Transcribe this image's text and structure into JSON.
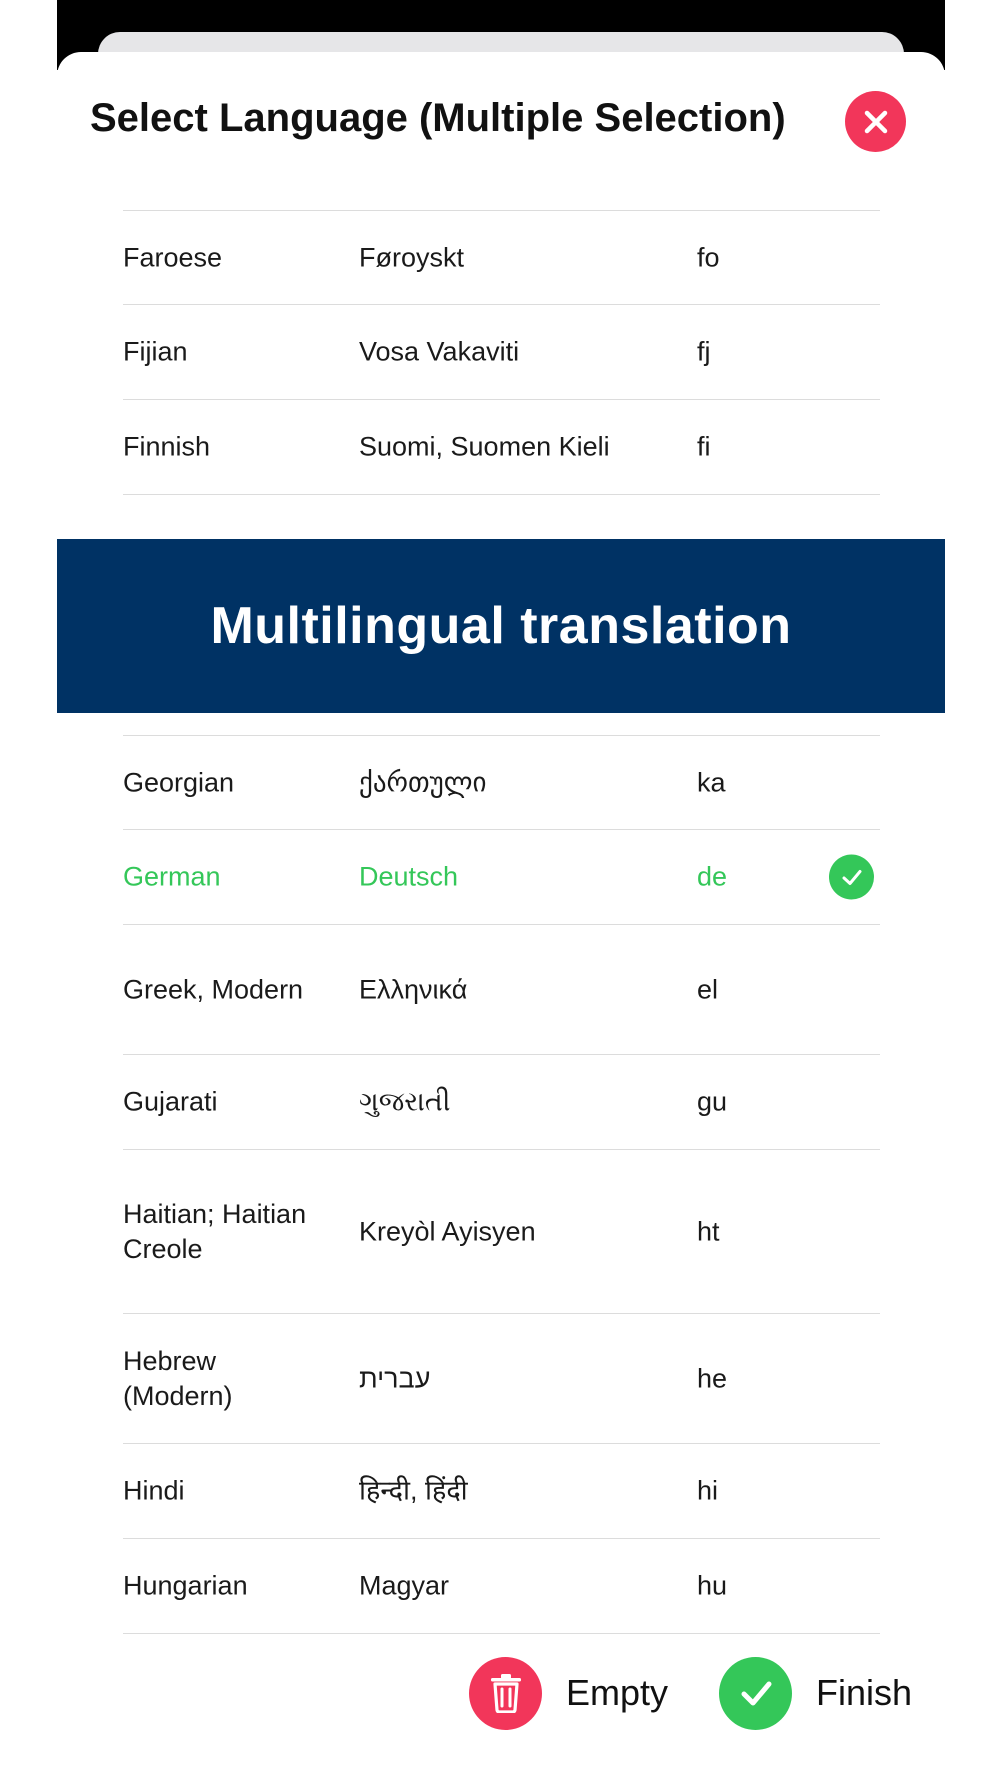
{
  "dialog": {
    "title": "Select Language (Multiple Selection)",
    "close_icon": "close-x-icon"
  },
  "banner": {
    "text": "Multilingual translation",
    "background": "#003264"
  },
  "languages_top": [
    {
      "name": "Faroese",
      "native": "Føroyskt",
      "code": "fo"
    },
    {
      "name": "Fijian",
      "native": "Vosa Vakaviti",
      "code": "fj"
    },
    {
      "name": "Finnish",
      "native": "Suomi, Suomen Kieli",
      "code": "fi"
    }
  ],
  "languages_bottom": [
    {
      "name": "Georgian",
      "native": "ქართული",
      "code": "ka"
    },
    {
      "name": "German",
      "native": "Deutsch",
      "code": "de",
      "selected": true
    },
    {
      "name": "Greek, Modern",
      "native": "Ελληνικά",
      "code": "el"
    },
    {
      "name": "Gujarati",
      "native": "ગુજરાતી",
      "code": "gu"
    },
    {
      "name": "Haitian; Haitian Creole",
      "native": "Kreyòl Ayisyen",
      "code": "ht"
    },
    {
      "name": "Hebrew (Modern)",
      "native": "עברית",
      "code": "he"
    },
    {
      "name": "Hindi",
      "native": "हिन्दी, हिंदी",
      "code": "hi"
    },
    {
      "name": "Hungarian",
      "native": "Magyar",
      "code": "hu"
    }
  ],
  "actions": {
    "empty_label": "Empty",
    "empty_icon": "trash-icon",
    "finish_label": "Finish",
    "finish_icon": "checkmark-icon"
  },
  "colors": {
    "accent_red": "#f2365a",
    "accent_green": "#34c759"
  }
}
